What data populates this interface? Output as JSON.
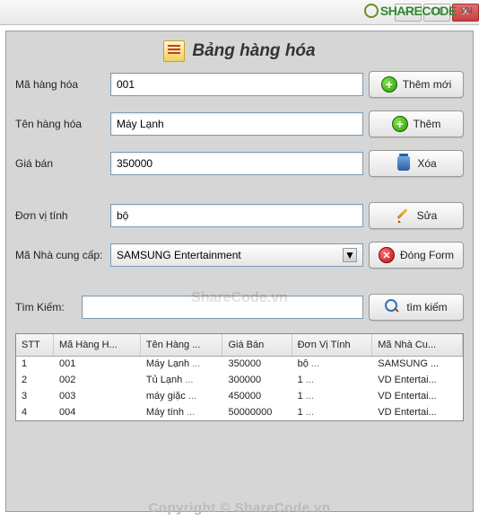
{
  "titlebar": {
    "text": ""
  },
  "header": {
    "title": "Bảng hàng hóa"
  },
  "labels": {
    "ma_hang": "Mã hàng hóa",
    "ten_hang": "Tên hàng hóa",
    "gia_ban": "Giá bán",
    "don_vi": "Đơn vị tính",
    "ma_ncc": "Mã Nhà cung cấp:",
    "tim_kiem": "Tìm Kiếm:"
  },
  "fields": {
    "ma_hang": "001",
    "ten_hang": "Máy Lạnh",
    "gia_ban": "350000",
    "don_vi": "bộ",
    "ma_ncc": "SAMSUNG Entertainment",
    "tim_kiem": ""
  },
  "buttons": {
    "them_moi": "Thêm mới",
    "them": "Thêm",
    "xoa": "Xóa",
    "sua": "Sửa",
    "dong": "Đóng Form",
    "tim": "tìm kiếm"
  },
  "table": {
    "headers": [
      "STT",
      "Mã Hàng H...",
      "Tên Hàng ...",
      "Giá Bán",
      "Đơn Vị Tính",
      "Mã Nhà Cu..."
    ],
    "rows": [
      [
        "1",
        "001",
        "Máy Lạnh",
        "350000",
        "bộ",
        "SAMSUNG ..."
      ],
      [
        "2",
        "002",
        "Tủ Lạnh",
        "300000",
        "1",
        "VD Entertai..."
      ],
      [
        "3",
        "003",
        "máy giặc",
        "450000",
        "1",
        "VD Entertai..."
      ],
      [
        "4",
        "004",
        "Máy tính",
        "50000000",
        "1",
        "VD Entertai..."
      ]
    ]
  },
  "watermarks": {
    "top": "SHARECODE",
    "top_vn": ".VN",
    "center": "ShareCode.vn",
    "bottom": "Copyright © ShareCode.vn"
  }
}
